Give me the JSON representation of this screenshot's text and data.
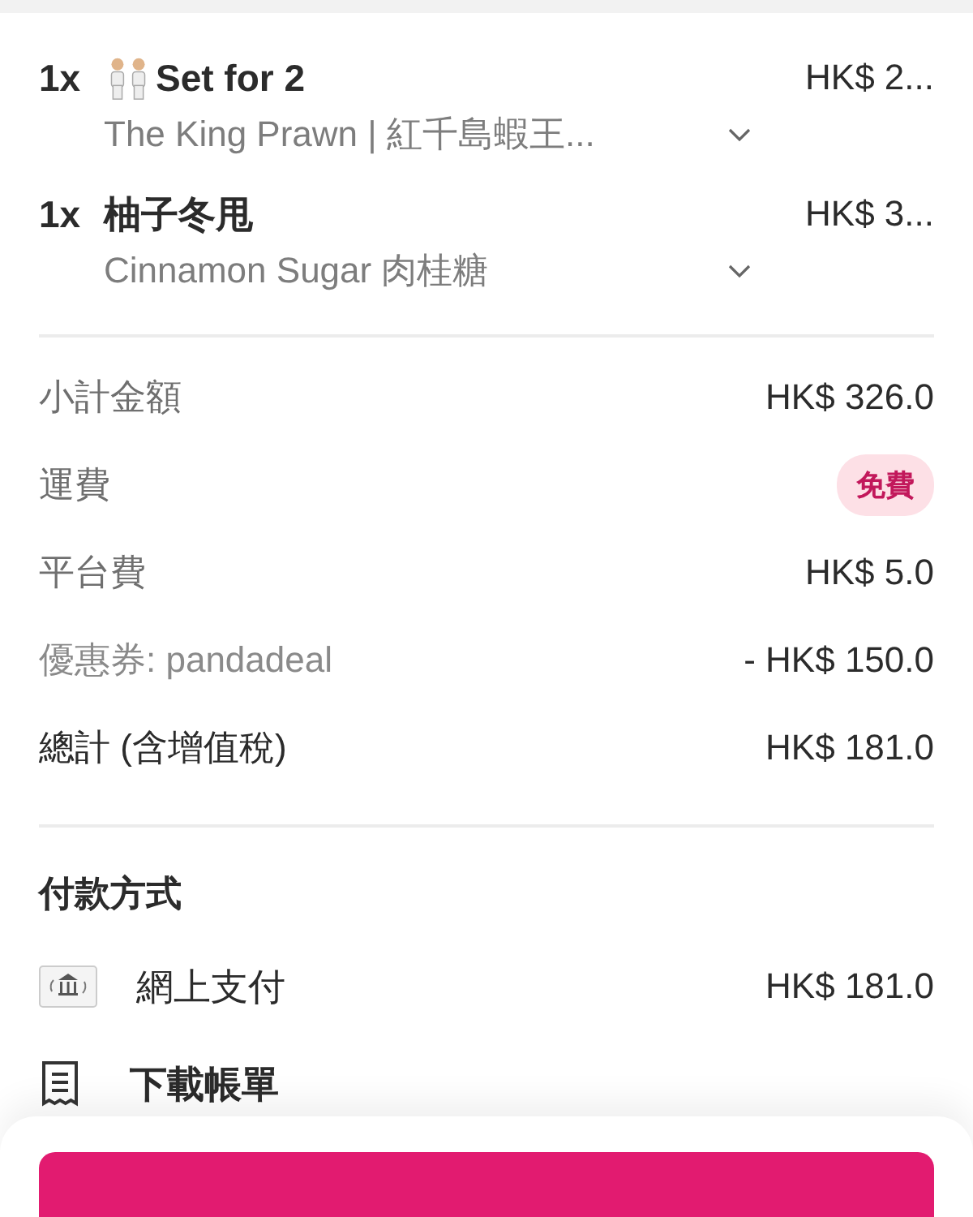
{
  "items": [
    {
      "kind": "set",
      "quantity": "1x",
      "name": "Set for 2",
      "price": "HK$ 2...",
      "details": "The King Prawn | 紅千島蝦王..."
    },
    {
      "kind": "single",
      "quantity": "1x",
      "name": "柚子冬甩",
      "price": "HK$ 3...",
      "details": "Cinnamon Sugar 肉桂糖"
    }
  ],
  "summary": [
    {
      "kind": "subtotal",
      "label": "小計金額",
      "value": "HK$ 326.0"
    },
    {
      "kind": "delivery",
      "label": "運費",
      "value": "免費"
    },
    {
      "kind": "fee",
      "label": "平台費",
      "value": "HK$ 5.0"
    },
    {
      "kind": "voucher",
      "label": "優惠券: pandadeal",
      "value": "- HK$ 150.0"
    },
    {
      "kind": "total",
      "label": "總計 (含增值稅)",
      "value": "HK$ 181.0"
    }
  ],
  "payment": {
    "title": "付款方式",
    "method": "網上支付",
    "amount": "HK$ 181.0"
  },
  "download": {
    "label": "下載帳單"
  }
}
